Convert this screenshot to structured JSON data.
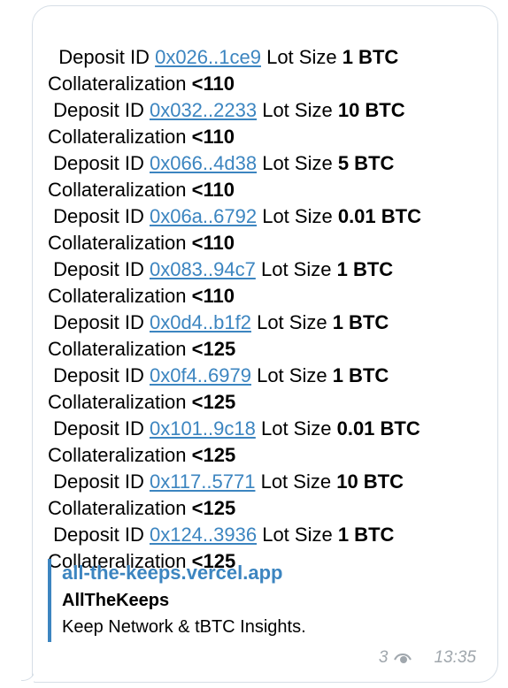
{
  "deposits": [
    {
      "label": "Deposit ID",
      "id": "0x026..1ce9",
      "lot_label": "Lot Size",
      "lot": "1 BTC",
      "coll_label": "Collateralization",
      "coll": "<110"
    },
    {
      "label": "Deposit ID",
      "id": "0x032..2233",
      "lot_label": "Lot Size",
      "lot": "10 BTC",
      "coll_label": "Collateralization",
      "coll": "<110"
    },
    {
      "label": "Deposit ID",
      "id": "0x066..4d38",
      "lot_label": "Lot Size",
      "lot": "5 BTC",
      "coll_label": "Collateralization",
      "coll": "<110"
    },
    {
      "label": "Deposit ID",
      "id": "0x06a..6792",
      "lot_label": "Lot Size",
      "lot": "0.01 BTC",
      "coll_label": "Collateralization",
      "coll": "<110"
    },
    {
      "label": "Deposit ID",
      "id": "0x083..94c7",
      "lot_label": "Lot Size",
      "lot": "1 BTC",
      "coll_label": "Collateralization",
      "coll": "<110"
    },
    {
      "label": "Deposit ID",
      "id": "0x0d4..b1f2",
      "lot_label": "Lot Size",
      "lot": "1 BTC",
      "coll_label": "Collateralization",
      "coll": "<125"
    },
    {
      "label": "Deposit ID",
      "id": "0x0f4..6979",
      "lot_label": "Lot Size",
      "lot": "1 BTC",
      "coll_label": "Collateralization",
      "coll": "<125"
    },
    {
      "label": "Deposit ID",
      "id": "0x101..9c18",
      "lot_label": "Lot Size",
      "lot": "0.01 BTC",
      "coll_label": "Collateralization",
      "coll": "<125"
    },
    {
      "label": "Deposit ID",
      "id": "0x117..5771",
      "lot_label": "Lot Size",
      "lot": "10 BTC",
      "coll_label": "Collateralization",
      "coll": "<125"
    },
    {
      "label": "Deposit ID",
      "id": "0x124..3936",
      "lot_label": "Lot Size",
      "lot": "1 BTC",
      "coll_label": "Collateralization",
      "coll": "<125"
    }
  ],
  "preview": {
    "site": "all-the-keeps.vercel.app",
    "title": "AllTheKeeps",
    "description": "Keep Network & tBTC Insights."
  },
  "meta": {
    "views": "3",
    "time": "13:35"
  },
  "icons": {
    "views": "eye-icon"
  },
  "colors": {
    "link": "#3c85c0",
    "meta": "#a0a7ad",
    "border": "#d6dee6"
  }
}
